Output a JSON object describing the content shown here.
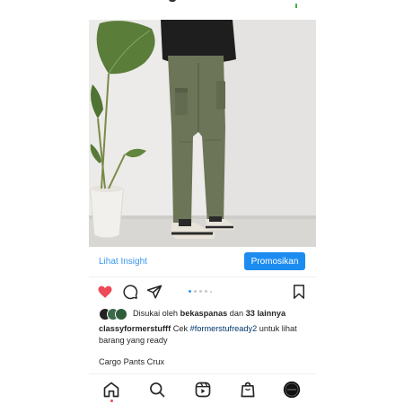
{
  "post": {
    "insight_label": "Lihat Insight",
    "promote_label": "Promosikan",
    "liked": true,
    "carousel": {
      "total": 5,
      "active": 1
    }
  },
  "likes": {
    "prefix": "Disukai oleh",
    "user": "bekaspanas",
    "connector": "dan",
    "others": "33 lainnya"
  },
  "caption": {
    "username": "classyformerstufff",
    "text_before": "Cek",
    "hashtag": "#formerstufready2",
    "text_after": "untuk lihat barang yang ready",
    "subtitle": "Cargo Pants Crux"
  },
  "colors": {
    "accent": "#3897f0",
    "button": "#1d8cf0",
    "like": "#ed4956",
    "hashtag": "#00376b"
  },
  "nav": {
    "items": [
      "home-icon",
      "search-icon",
      "reels-icon",
      "shop-icon",
      "profile-avatar"
    ]
  }
}
